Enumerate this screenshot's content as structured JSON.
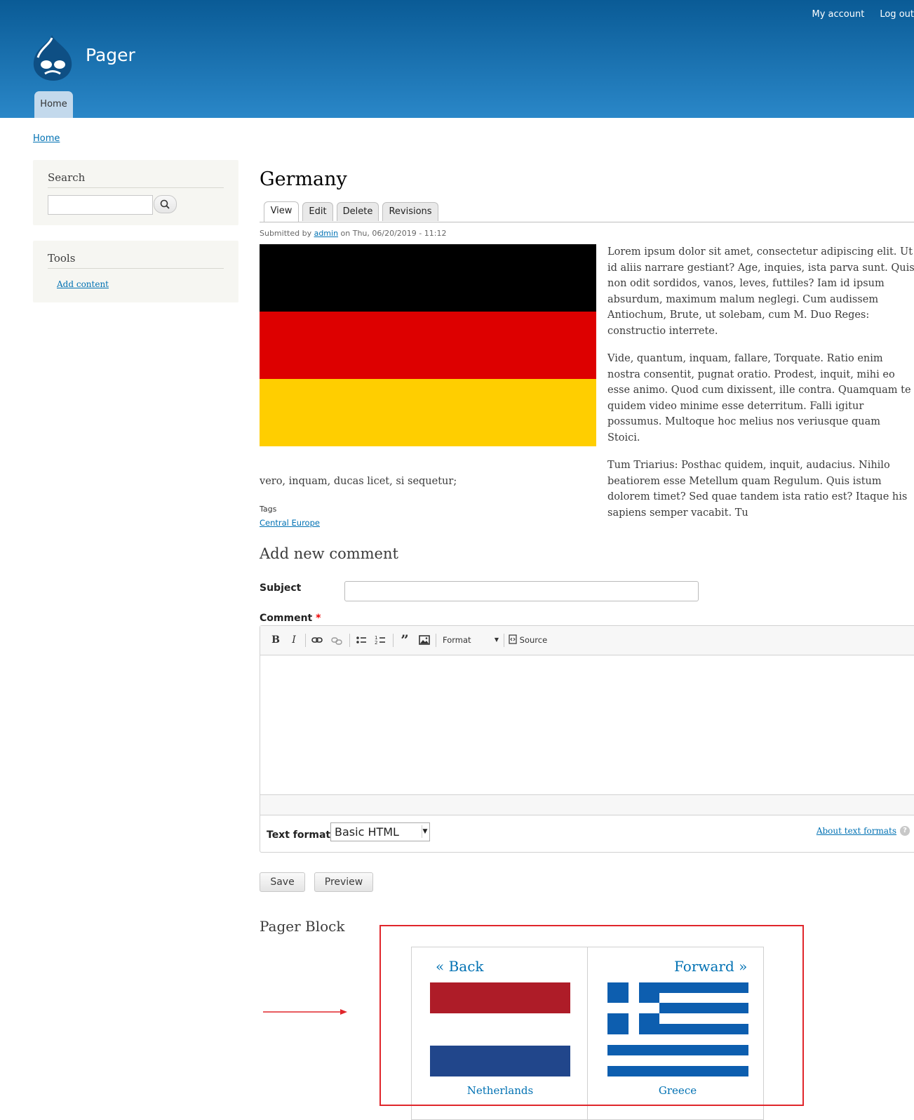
{
  "site": {
    "name": "Pager"
  },
  "secondary_menu": [
    "My account",
    "Log out"
  ],
  "main_menu": {
    "home": "Home"
  },
  "breadcrumb": "Home",
  "sidebar": {
    "search": {
      "title": "Search",
      "placeholder": ""
    },
    "tools": {
      "title": "Tools",
      "link": "Add content"
    }
  },
  "node": {
    "title": "Germany",
    "tabs": [
      "View",
      "Edit",
      "Delete",
      "Revisions"
    ],
    "submitted_prefix": "Submitted by",
    "author": "admin",
    "date": "on Thu, 06/20/2019 - 11:12",
    "paragraphs": [
      "Lorem ipsum dolor sit amet, consectetur adipiscing elit. Ut id aliis narrare gestiant? Age, inquies, ista parva sunt. Quis non odit sordidos, vanos, leves, futtiles? Iam id ipsum absurdum, maximum malum neglegi. Cum audissem Antiochum, Brute, ut solebam, cum M. Duo Reges: constructio interrete.",
      "Vide, quantum, inquam, fallare, Torquate. Ratio enim nostra consentit, pugnat oratio. Prodest, inquit, mihi eo esse animo. Quod cum dixissent, ille contra. Quamquam te quidem video minime esse deterritum. Falli igitur possumus. Multoque hoc melius nos veriusque quam Stoici.",
      "Tum Triarius: Posthac quidem, inquit, audacius. Nihilo beatiorem esse Metellum quam Regulum. Quis istum dolorem timet? Sed quae tandem ista ratio est? Itaque his sapiens semper vacabit. Tu"
    ],
    "paragraph_tail": "vero, inquam, ducas licet, si sequetur;",
    "tags_label": "Tags",
    "tag": "Central Europe",
    "flag_colors": [
      "#000000",
      "#dd0000",
      "#ffce00"
    ]
  },
  "comment_form": {
    "heading": "Add new comment",
    "subject_label": "Subject",
    "subject_value": "",
    "comment_label": "Comment",
    "required_mark": "*",
    "toolbar": {
      "format": "Format",
      "source": "Source"
    },
    "text_format_label": "Text format",
    "text_format_value": "Basic HTML",
    "about_link": "About text formats",
    "help": "?",
    "save": "Save",
    "preview": "Preview"
  },
  "pager_block": {
    "heading": "Pager Block",
    "back": "« Back",
    "forward": "Forward »",
    "prev_caption": "Netherlands",
    "next_caption": "Greece",
    "highlight_color": "#e0262b"
  }
}
